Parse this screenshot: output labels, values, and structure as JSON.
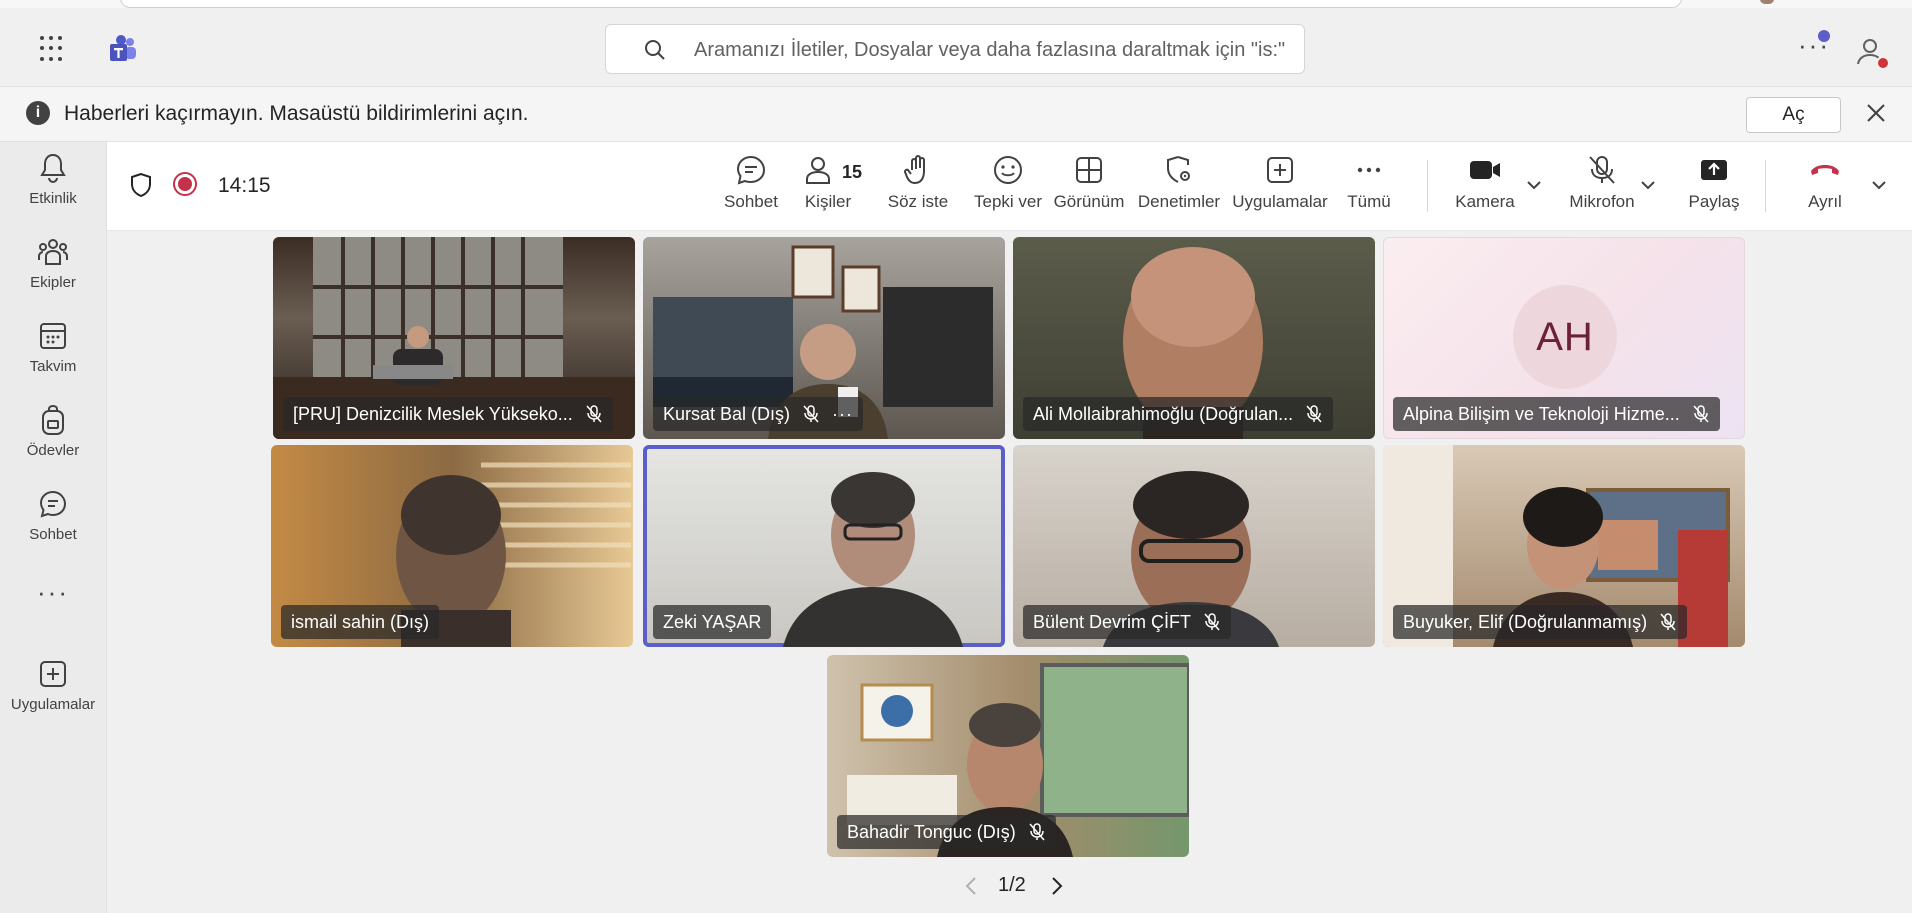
{
  "titlebar": {
    "search_placeholder": "Aramanızı İletiler, Dosyalar veya daha fazlasına daraltmak için \"is:\""
  },
  "banner": {
    "message": "Haberleri kaçırmayın. Masaüstü bildirimlerini açın.",
    "open_label": "Aç"
  },
  "rail": {
    "items": [
      {
        "label": "Etkinlik",
        "icon": "bell-icon"
      },
      {
        "label": "Ekipler",
        "icon": "teams-icon"
      },
      {
        "label": "Takvim",
        "icon": "calendar-icon"
      },
      {
        "label": "Ödevler",
        "icon": "backpack-icon"
      },
      {
        "label": "Sohbet",
        "icon": "chat-icon"
      },
      {
        "label": "Uygulamalar",
        "icon": "add-app-icon"
      }
    ]
  },
  "toolbar": {
    "time": "14:15",
    "participants_count": "15",
    "buttons": {
      "chat": "Sohbet",
      "people": "Kişiler",
      "raise_hand": "Söz iste",
      "react": "Tepki ver",
      "view": "Görünüm",
      "controls": "Denetimler",
      "apps": "Uygulamalar",
      "more": "Tümü",
      "camera": "Kamera",
      "mic": "Mikrofon",
      "share": "Paylaş",
      "leave": "Ayrıl"
    }
  },
  "participants": [
    {
      "name": "[PRU] Denizcilik Meslek Yükseko...",
      "muted": true
    },
    {
      "name": "Kursat Bal (Dış)",
      "muted": true,
      "more": "···"
    },
    {
      "name": "Ali Mollaibrahimoğlu (Doğrulan...",
      "muted": true
    },
    {
      "name": "Alpina Bilişim ve Teknoloji Hizme...",
      "muted": true,
      "initials": "AH"
    },
    {
      "name": "ismail sahin (Dış)",
      "muted": false
    },
    {
      "name": "Zeki YAŞAR",
      "muted": false,
      "active_speaker": true
    },
    {
      "name": "Bülent Devrim ÇİFT",
      "muted": true
    },
    {
      "name": "Buyuker, Elif (Doğrulanmamış)",
      "muted": true
    },
    {
      "name": "Bahadir Tonguc (Dış)",
      "muted": true
    }
  ],
  "pager": {
    "label": "1/2"
  },
  "colors": {
    "accent": "#5b5fc7",
    "leave": "#c4314b",
    "record": "#c4314b"
  }
}
